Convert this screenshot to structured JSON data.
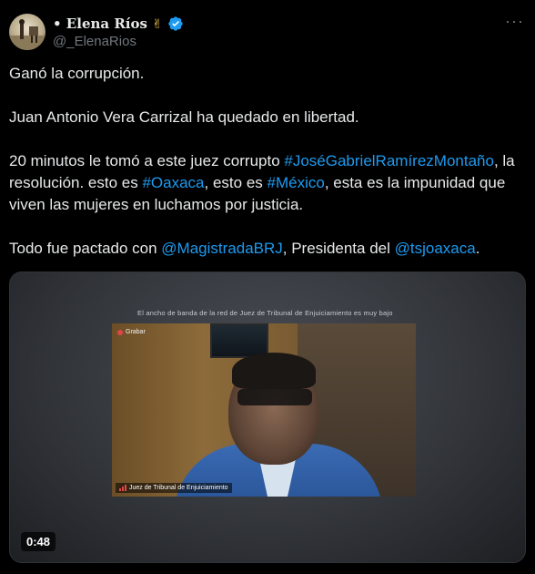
{
  "author": {
    "display_name": "• Elena Ríos",
    "name_emoji": "✌",
    "handle": "@_ElenaRios"
  },
  "tweet": {
    "line1": "Ganó la corrupción.",
    "line2": "Juan Antonio Vera Carrizal ha quedado en libertad.",
    "p3_a": "20 minutos le tomó a este juez corrupto ",
    "p3_link1": "#JoséGabrielRamírezMontaño",
    "p3_b": ", la resolución. esto es ",
    "p3_link2": "#Oaxaca",
    "p3_c": ", esto es ",
    "p3_link3": "#México",
    "p3_d": ", esta es la impunidad que viven las mujeres en luchamos por justicia.",
    "p4_a": "Todo fue pactado con ",
    "p4_link1": "@MagistradaBRJ",
    "p4_b": ", Presidenta del ",
    "p4_link2": "@tsjoaxaca",
    "p4_c": "."
  },
  "video": {
    "banner": "El ancho de banda de la red de Juez de Tribunal de Enjuiciamiento es muy bajo",
    "recording_label": "Grabar",
    "participant_name": "Juez de Tribunal de Enjuiciamiento",
    "duration": "0:48"
  },
  "colors": {
    "background": "#000000",
    "text": "#e7e9ea",
    "muted": "#71767b",
    "link": "#1d9bf0"
  },
  "icons": {
    "verified": "verified-badge-icon",
    "more": "more-icon"
  }
}
